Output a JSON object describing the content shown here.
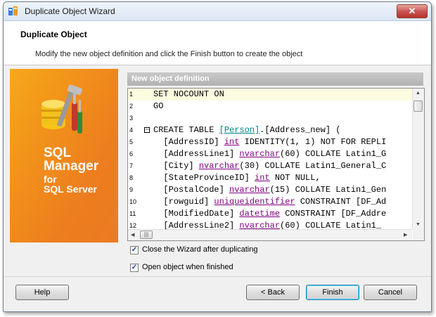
{
  "window": {
    "title": "Duplicate Object Wizard",
    "close_glyph": "✕"
  },
  "header": {
    "title": "Duplicate Object",
    "description": "Modify the new object definition and click the Finish button to create the object"
  },
  "banner": {
    "line1": "SQL",
    "line2": "Manager",
    "line3": "for",
    "line4": "SQL Server",
    "icon": "tools-database-icon"
  },
  "definition_panel": {
    "title": "New object definition",
    "lines": [
      {
        "num": "1",
        "parts": [
          {
            "t": "SET NOCOUNT ON",
            "c": "kw"
          }
        ]
      },
      {
        "num": "2",
        "parts": [
          {
            "t": "GO",
            "c": "kw"
          }
        ]
      },
      {
        "num": "3",
        "parts": []
      },
      {
        "num": "4",
        "parts": [
          {
            "t": "CREATE TABLE ",
            "c": "kw"
          },
          {
            "t": "[Person]",
            "c": "tb"
          },
          {
            "t": ".[Address_new] (",
            "c": "kw"
          }
        ]
      },
      {
        "num": "5",
        "parts": [
          {
            "t": "  [AddressID] ",
            "c": "kw"
          },
          {
            "t": "int",
            "c": "tp"
          },
          {
            "t": " IDENTITY(1, 1) NOT FOR REPLI",
            "c": "kw"
          }
        ]
      },
      {
        "num": "6",
        "parts": [
          {
            "t": "  [AddressLine1] ",
            "c": "kw"
          },
          {
            "t": "nvarchar",
            "c": "tp"
          },
          {
            "t": "(60) COLLATE Latin1_G",
            "c": "kw"
          }
        ]
      },
      {
        "num": "7",
        "parts": [
          {
            "t": "  [City] ",
            "c": "kw"
          },
          {
            "t": "nvarchar",
            "c": "tp"
          },
          {
            "t": "(30) COLLATE Latin1_General_C",
            "c": "kw"
          }
        ]
      },
      {
        "num": "8",
        "parts": [
          {
            "t": "  [StateProvinceID] ",
            "c": "kw"
          },
          {
            "t": "int",
            "c": "tp"
          },
          {
            "t": " NOT NULL,",
            "c": "kw"
          }
        ]
      },
      {
        "num": "9",
        "parts": [
          {
            "t": "  [PostalCode] ",
            "c": "kw"
          },
          {
            "t": "nvarchar",
            "c": "tp"
          },
          {
            "t": "(15) COLLATE Latin1_Gen",
            "c": "kw"
          }
        ]
      },
      {
        "num": "10",
        "parts": [
          {
            "t": "  [rowguid] ",
            "c": "kw"
          },
          {
            "t": "uniqueidentifier",
            "c": "tp"
          },
          {
            "t": " CONSTRAINT [DF_Ad",
            "c": "kw"
          }
        ]
      },
      {
        "num": "11",
        "parts": [
          {
            "t": "  [ModifiedDate] ",
            "c": "kw"
          },
          {
            "t": "datetime",
            "c": "tp"
          },
          {
            "t": " CONSTRAINT [DF_Addre",
            "c": "kw"
          }
        ]
      },
      {
        "num": "12",
        "parts": [
          {
            "t": "  [AddressLine2] ",
            "c": "kw"
          },
          {
            "t": "nvarchar",
            "c": "tp"
          },
          {
            "t": "(60) COLLATE Latin1_",
            "c": "kw"
          }
        ]
      }
    ]
  },
  "options": {
    "close_after": {
      "label": "Close the Wizard after duplicating",
      "checked": true
    },
    "open_when_finished": {
      "label": "Open object when finished",
      "checked": true
    }
  },
  "buttons": {
    "help": "Help",
    "back": "< Back",
    "finish": "Finish",
    "cancel": "Cancel"
  }
}
